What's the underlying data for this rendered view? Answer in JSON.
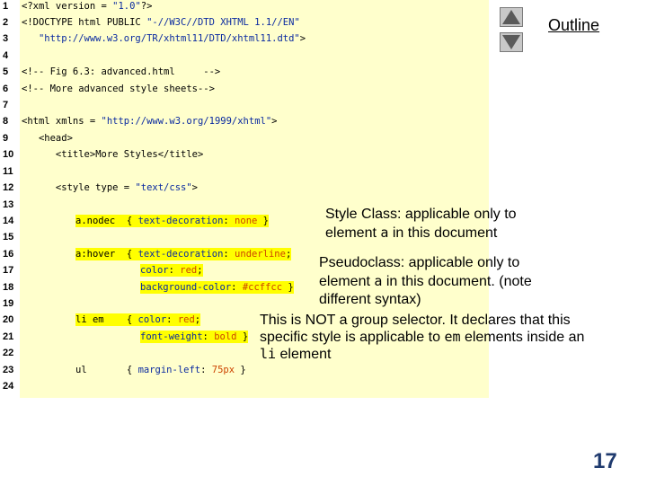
{
  "nav": {
    "outline_label": "Outline",
    "page_number": "17"
  },
  "code": {
    "line_numbers": [
      "1",
      "2",
      "3",
      "4",
      "5",
      "6",
      "7",
      "8",
      "9",
      "10",
      "11",
      "12",
      "13",
      "14",
      "15",
      "16",
      "17",
      "18",
      "19",
      "20",
      "21",
      "22",
      "23",
      "24"
    ],
    "l1_a": "<?xml version = ",
    "l1_b": "\"1.0\"",
    "l1_c": "?>",
    "l2_a": "<!DOCTYPE html PUBLIC ",
    "l2_b": "\"-//W3C//DTD XHTML 1.1//EN\"",
    "l3_a": "   \"http://www.w3.org/TR/xhtml11/DTD/xhtml11.dtd\"",
    "l3_b": ">",
    "l5": "<!-- Fig 6.3: advanced.html     -->",
    "l6": "<!-- More advanced style sheets-->",
    "l8_a": "<html xmlns = ",
    "l8_b": "\"http://www.w3.org/1999/xhtml\"",
    "l8_c": ">",
    "l9": "   <head>",
    "l10_a": "      <title>",
    "l10_b": "More Styles",
    "l10_c": "</title>",
    "l12_a": "      <style type = ",
    "l12_b": "\"text/css\"",
    "l12_c": ">",
    "l14_sel": "a.nodec",
    "l14_b": "  { ",
    "l14_p": "text-decoration",
    "l14_c": ": ",
    "l14_v": "none",
    "l14_d": " }",
    "l16_sel": "a:hover",
    "l16_b": "  { ",
    "l16_p": "text-decoration",
    "l16_c": ": ",
    "l16_v": "underline",
    "l16_d": ";",
    "l17_p": "color",
    "l17_c": ": ",
    "l17_v": "red",
    "l17_d": ";",
    "l18_p": "background-color",
    "l18_c": ": ",
    "l18_v": "#ccffcc",
    "l18_d": " }",
    "l20_sel": "li em",
    "l20_b": "    { ",
    "l20_p": "color",
    "l20_c": ": ",
    "l20_v": "red",
    "l20_d": ";",
    "l21_p": "font-weight",
    "l21_c": ": ",
    "l21_v": "bold",
    "l21_d": " }",
    "l23_sel": "ul",
    "l23_b": "       { ",
    "l23_p": "margin-left",
    "l23_c": ": ",
    "l23_v": "75px",
    "l23_d": " }"
  },
  "annotations": {
    "arrow": "",
    "arrow_left": "",
    "a1_l1": "Style Class: applicable only to",
    "a1_l2a": "element ",
    "a1_l2b": "a",
    "a1_l2c": " in this document",
    "a2_l1": "Pseudoclass: applicable only to",
    "a2_l2a": "element ",
    "a2_l2b": "a",
    "a2_l2c": " in this document. (note",
    "a2_l3": "different syntax)",
    "a3_l1": "This is NOT a group selector. It declares that this",
    "a3_l2a": "specific style is applicable to ",
    "a3_l2b": "em",
    "a3_l2c": " elements inside an",
    "a3_l3a": "li",
    "a3_l3b": " element"
  },
  "colors": {
    "code_bg": "#ffffcc",
    "highlight": "#ffff00",
    "keyword_blue": "#0a2aa0",
    "value_orange": "#cc4400",
    "page_number": "#1f3a6e"
  }
}
